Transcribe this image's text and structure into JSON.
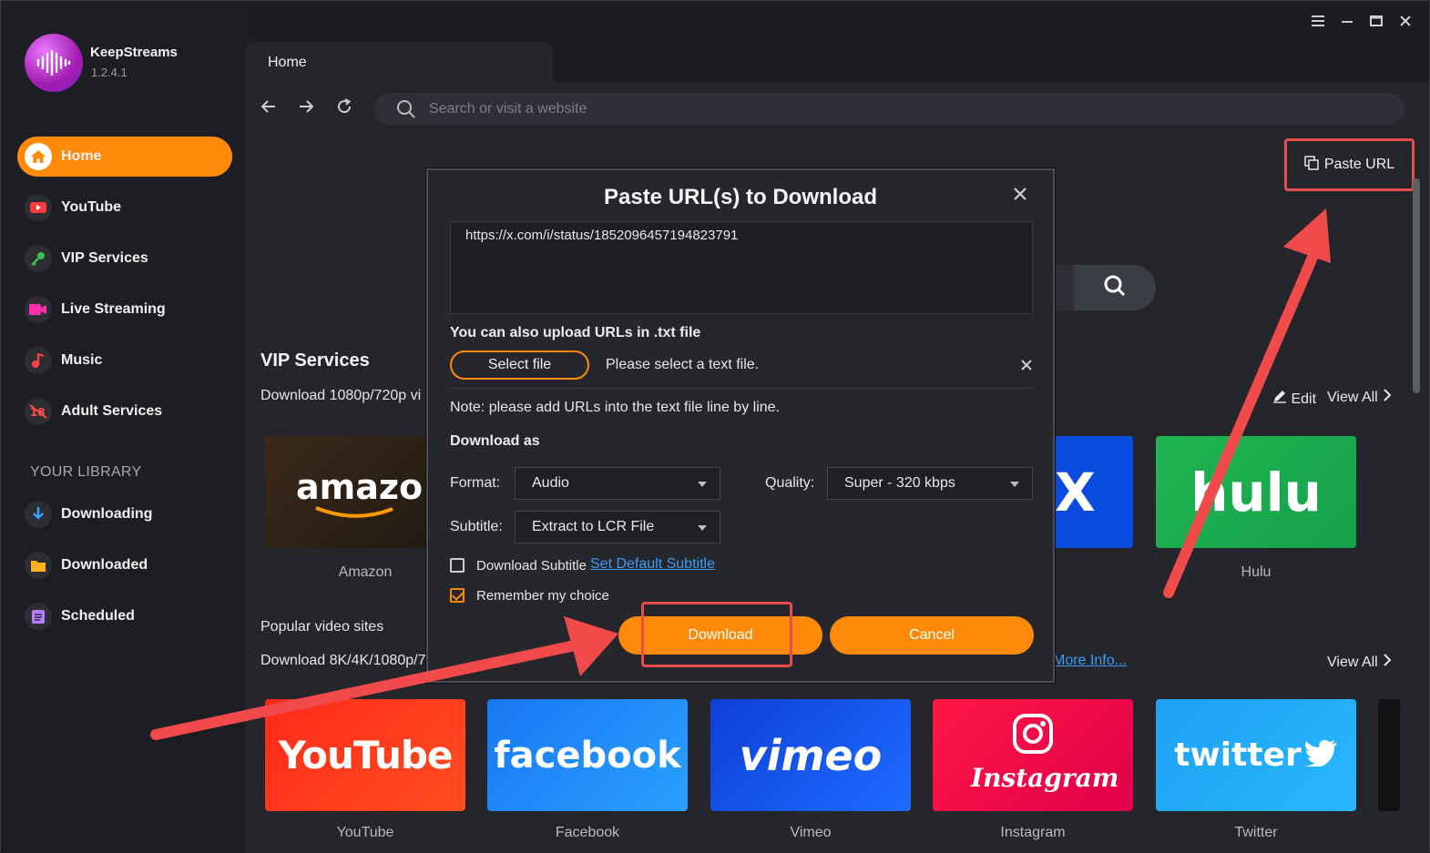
{
  "app": {
    "name": "KeepStreams",
    "version": "1.2.4.1"
  },
  "sidebar": {
    "items": [
      {
        "label": "Home"
      },
      {
        "label": "YouTube"
      },
      {
        "label": "VIP Services"
      },
      {
        "label": "Live Streaming"
      },
      {
        "label": "Music"
      },
      {
        "label": "Adult Services"
      }
    ],
    "library_title": "YOUR LIBRARY",
    "library": [
      {
        "label": "Downloading"
      },
      {
        "label": "Downloaded"
      },
      {
        "label": "Scheduled"
      }
    ]
  },
  "tab": {
    "label": "Home"
  },
  "search": {
    "placeholder": "Search or visit a website"
  },
  "paste_url": {
    "label": "Paste URL"
  },
  "vip": {
    "title": "VIP Services",
    "subtitle": "Download 1080p/720p vi",
    "edit_label": "Edit",
    "view_all": "View All",
    "tiles": [
      {
        "logo": "amazon",
        "label": "Amazon"
      },
      {
        "logo": "X",
        "label": ""
      },
      {
        "logo": "hulu",
        "label": "Hulu"
      }
    ]
  },
  "popular": {
    "title": "Popular video sites",
    "subtitle": "Download 8K/4K/1080p/7",
    "more_info": "More Info...",
    "view_all": "View All",
    "tiles": [
      {
        "logo": "YouTube",
        "label": "YouTube"
      },
      {
        "logo": "facebook",
        "label": "Facebook"
      },
      {
        "logo": "vimeo",
        "label": "Vimeo"
      },
      {
        "logo": "Instagram",
        "label": "Instagram"
      },
      {
        "logo": "twitter",
        "label": "Twitter"
      }
    ]
  },
  "dialog": {
    "title": "Paste URL(s) to Download",
    "url_value": "https://x.com/i/status/1852096457194823791",
    "upload_label": "You can also upload URLs in .txt file",
    "select_file": "Select file",
    "select_hint": "Please select a text file.",
    "note": "Note: please add URLs into the text file line by line.",
    "download_as": "Download as",
    "format_label": "Format:",
    "format_value": "Audio",
    "quality_label": "Quality:",
    "quality_value": "Super - 320 kbps",
    "subtitle_label": "Subtitle:",
    "subtitle_value": "Extract to LCR File",
    "download_subtitle": "Download Subtitle",
    "set_default_subtitle": "Set Default Subtitle",
    "remember_choice": "Remember my choice",
    "download_btn": "Download",
    "cancel_btn": "Cancel",
    "download_subtitle_checked": false,
    "remember_checked": true
  },
  "colors": {
    "accent": "#ff8a0a",
    "highlight": "#e84d4d",
    "link": "#3b9cf5"
  }
}
